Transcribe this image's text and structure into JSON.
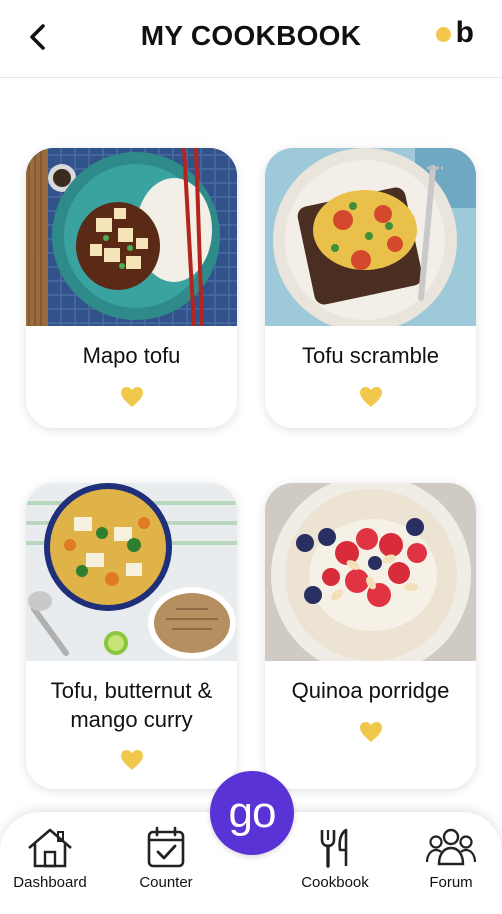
{
  "header": {
    "title": "MY COOKBOOK",
    "brand_letter": "b",
    "back_icon": "chevron-left-icon",
    "brand_dot_color": "#f1c84b"
  },
  "recipes": [
    {
      "name": "Mapo tofu",
      "favorite": true
    },
    {
      "name": "Tofu scramble",
      "favorite": true
    },
    {
      "name": "Tofu, butternut & mango curry",
      "favorite": true
    },
    {
      "name": "Quinoa porridge",
      "favorite": true
    }
  ],
  "accent_heart_color": "#f1c84b",
  "go_button": {
    "label": "go",
    "color": "#5a33d6"
  },
  "tabbar": {
    "tabs": [
      {
        "label": "Dashboard",
        "icon": "house-icon"
      },
      {
        "label": "Counter",
        "icon": "calendar-check-icon"
      },
      {
        "label": "Cookbook",
        "icon": "fork-knife-icon"
      },
      {
        "label": "Forum",
        "icon": "people-icon"
      }
    ]
  }
}
